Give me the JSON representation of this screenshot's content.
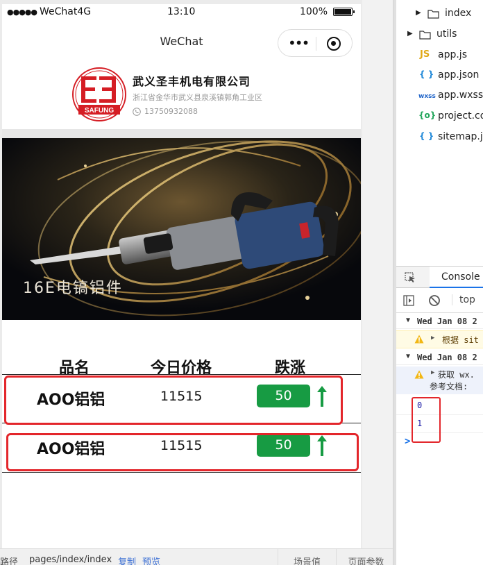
{
  "statusbar": {
    "carrier": "WeChat4G",
    "time": "13:10",
    "battery": "100%"
  },
  "navbar": {
    "title": "WeChat"
  },
  "company": {
    "name": "武义圣丰机电有限公司",
    "address": "浙江省金华市武义县泉溪镇郭角工业区",
    "phone": "13750932088",
    "logo_text": "SAFUNG"
  },
  "banner": {
    "caption": "16E电镐铝件"
  },
  "table": {
    "headers": [
      "品名",
      "今日价格",
      "跌涨"
    ],
    "rows": [
      {
        "name": "AOO铝铝",
        "price": "11515",
        "change": "50",
        "trend": "up"
      },
      {
        "name": "AOO铝铝",
        "price": "11515",
        "change": "50",
        "trend": "up"
      }
    ],
    "badge_color": "#179b43",
    "highlight_color": "#e3262b"
  },
  "pathbar": {
    "label": "路径",
    "value": "pages/index/index",
    "copy": "复制",
    "preview": "预览",
    "scene_btn": "场景值",
    "params_btn": "页面参数"
  },
  "filetree": [
    {
      "type": "folder",
      "label": "index",
      "level": 2
    },
    {
      "type": "folder",
      "label": "utils",
      "level": 1
    },
    {
      "type": "file",
      "icon": "JS",
      "label": "app.js"
    },
    {
      "type": "file",
      "icon": "{ }",
      "label": "app.json"
    },
    {
      "type": "file",
      "icon": "wxss",
      "label": "app.wxss"
    },
    {
      "type": "file",
      "icon": "{o}",
      "label": "project.co"
    },
    {
      "type": "file",
      "icon": "{ }",
      "label": "sitemap.js"
    }
  ],
  "devtools": {
    "tab": "Console",
    "context": "top",
    "logs": {
      "group1": "Wed Jan 08 2",
      "warn1": "根据 sit",
      "group2": "Wed Jan 08 2",
      "warn2_line1": "获取 wx.",
      "warn2_line2": "参考文档: ",
      "num0": "0",
      "num1": "1",
      "prompt": ">"
    }
  }
}
